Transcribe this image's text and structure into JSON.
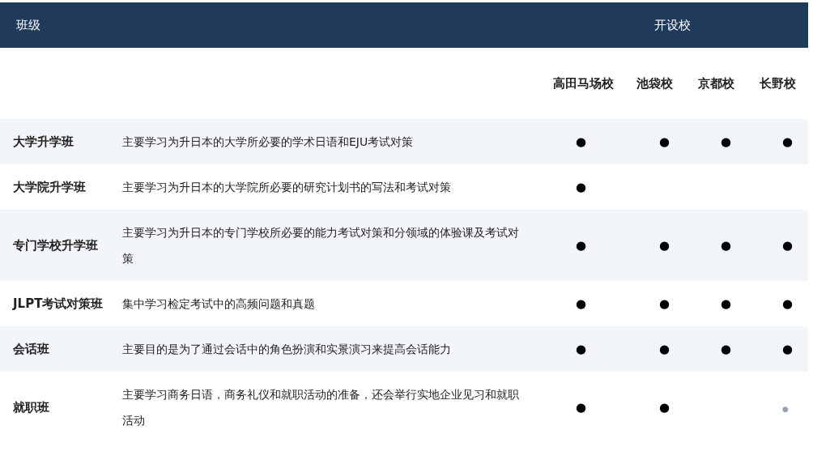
{
  "header": {
    "class_label": "班级",
    "schools_label": "开设校"
  },
  "schools": [
    "高田马场校",
    "池袋校",
    "京都校",
    "长野校"
  ],
  "rows": [
    {
      "name": "大学升学班",
      "description": "主要学习为升日本的大学所必要的学术日语和EJU考试对策",
      "cells": [
        {
          "mark": "●",
          "kind": "solid"
        },
        {
          "mark": "●",
          "kind": "solid"
        },
        {
          "mark": "●",
          "kind": "solid"
        },
        {
          "mark": "●",
          "kind": "solid"
        }
      ]
    },
    {
      "name": "大学院升学班",
      "description": "主要学习为升日本的大学院所必要的研究计划书的写法和考试对策",
      "cells": [
        {
          "mark": "●",
          "kind": "solid"
        },
        null,
        null,
        null
      ]
    },
    {
      "name": "专门学校升学班",
      "description": "主要学习为升日本的专门学校所必要的能力考试对策和分领域的体验课及考试对策",
      "cells": [
        {
          "mark": "●",
          "kind": "solid"
        },
        {
          "mark": "●",
          "kind": "solid"
        },
        {
          "mark": "●",
          "kind": "solid"
        },
        {
          "mark": "●",
          "kind": "solid"
        }
      ]
    },
    {
      "name": "JLPT考试对策班",
      "description": "集中学习检定考试中的高频问题和真题",
      "cells": [
        {
          "mark": "●",
          "kind": "solid"
        },
        {
          "mark": "●",
          "kind": "solid"
        },
        {
          "mark": "●",
          "kind": "solid"
        },
        {
          "mark": "●",
          "kind": "solid"
        }
      ]
    },
    {
      "name": "会话班",
      "description": "主要目的是为了通过会话中的角色扮演和实景演习来提高会话能力",
      "cells": [
        {
          "mark": "●",
          "kind": "solid"
        },
        {
          "mark": "●",
          "kind": "solid"
        },
        {
          "mark": "●",
          "kind": "solid"
        },
        {
          "mark": "●",
          "kind": "solid"
        }
      ]
    },
    {
      "name": "就职班",
      "description": "主要学习商务日语，商务礼仪和就职活动的准备，还会举行实地企业见习和就职活动",
      "cells": [
        {
          "mark": "●",
          "kind": "solid"
        },
        {
          "mark": "●",
          "kind": "solid"
        },
        null,
        {
          "mark": "●",
          "kind": "faint"
        }
      ]
    }
  ]
}
